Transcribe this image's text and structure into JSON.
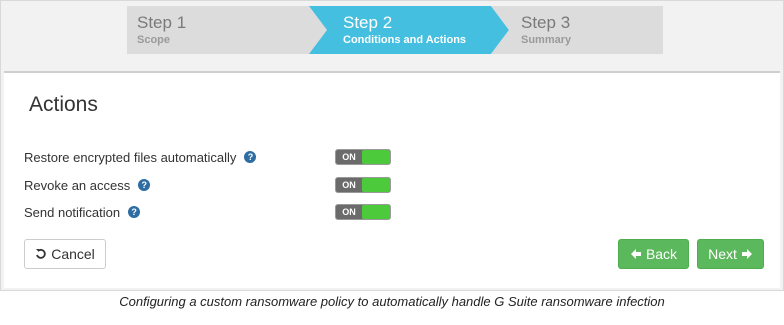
{
  "wizard": {
    "steps": [
      {
        "title": "Step 1",
        "subtitle": "Scope",
        "state": "done"
      },
      {
        "title": "Step 2",
        "subtitle": "Conditions and Actions",
        "state": "active"
      },
      {
        "title": "Step 3",
        "subtitle": "Summary",
        "state": "pending"
      }
    ]
  },
  "panel": {
    "title": "Actions",
    "rows": [
      {
        "label": "Restore encrypted files automatically",
        "toggle": "ON"
      },
      {
        "label": "Revoke an access",
        "toggle": "ON"
      },
      {
        "label": "Send notification",
        "toggle": "ON"
      }
    ],
    "help_glyph": "?"
  },
  "buttons": {
    "cancel": "Cancel",
    "back": "Back",
    "next": "Next"
  },
  "caption": "Configuring a custom ransomware policy to automatically handle G Suite ransomware infection",
  "colors": {
    "active_step": "#45bfe0",
    "toggle_on": "#4cca3c",
    "primary_button": "#5cb85c"
  },
  "icons": {
    "cancel": "undo-icon",
    "back": "arrow-left-icon",
    "next": "arrow-right-icon",
    "help": "help-icon"
  }
}
